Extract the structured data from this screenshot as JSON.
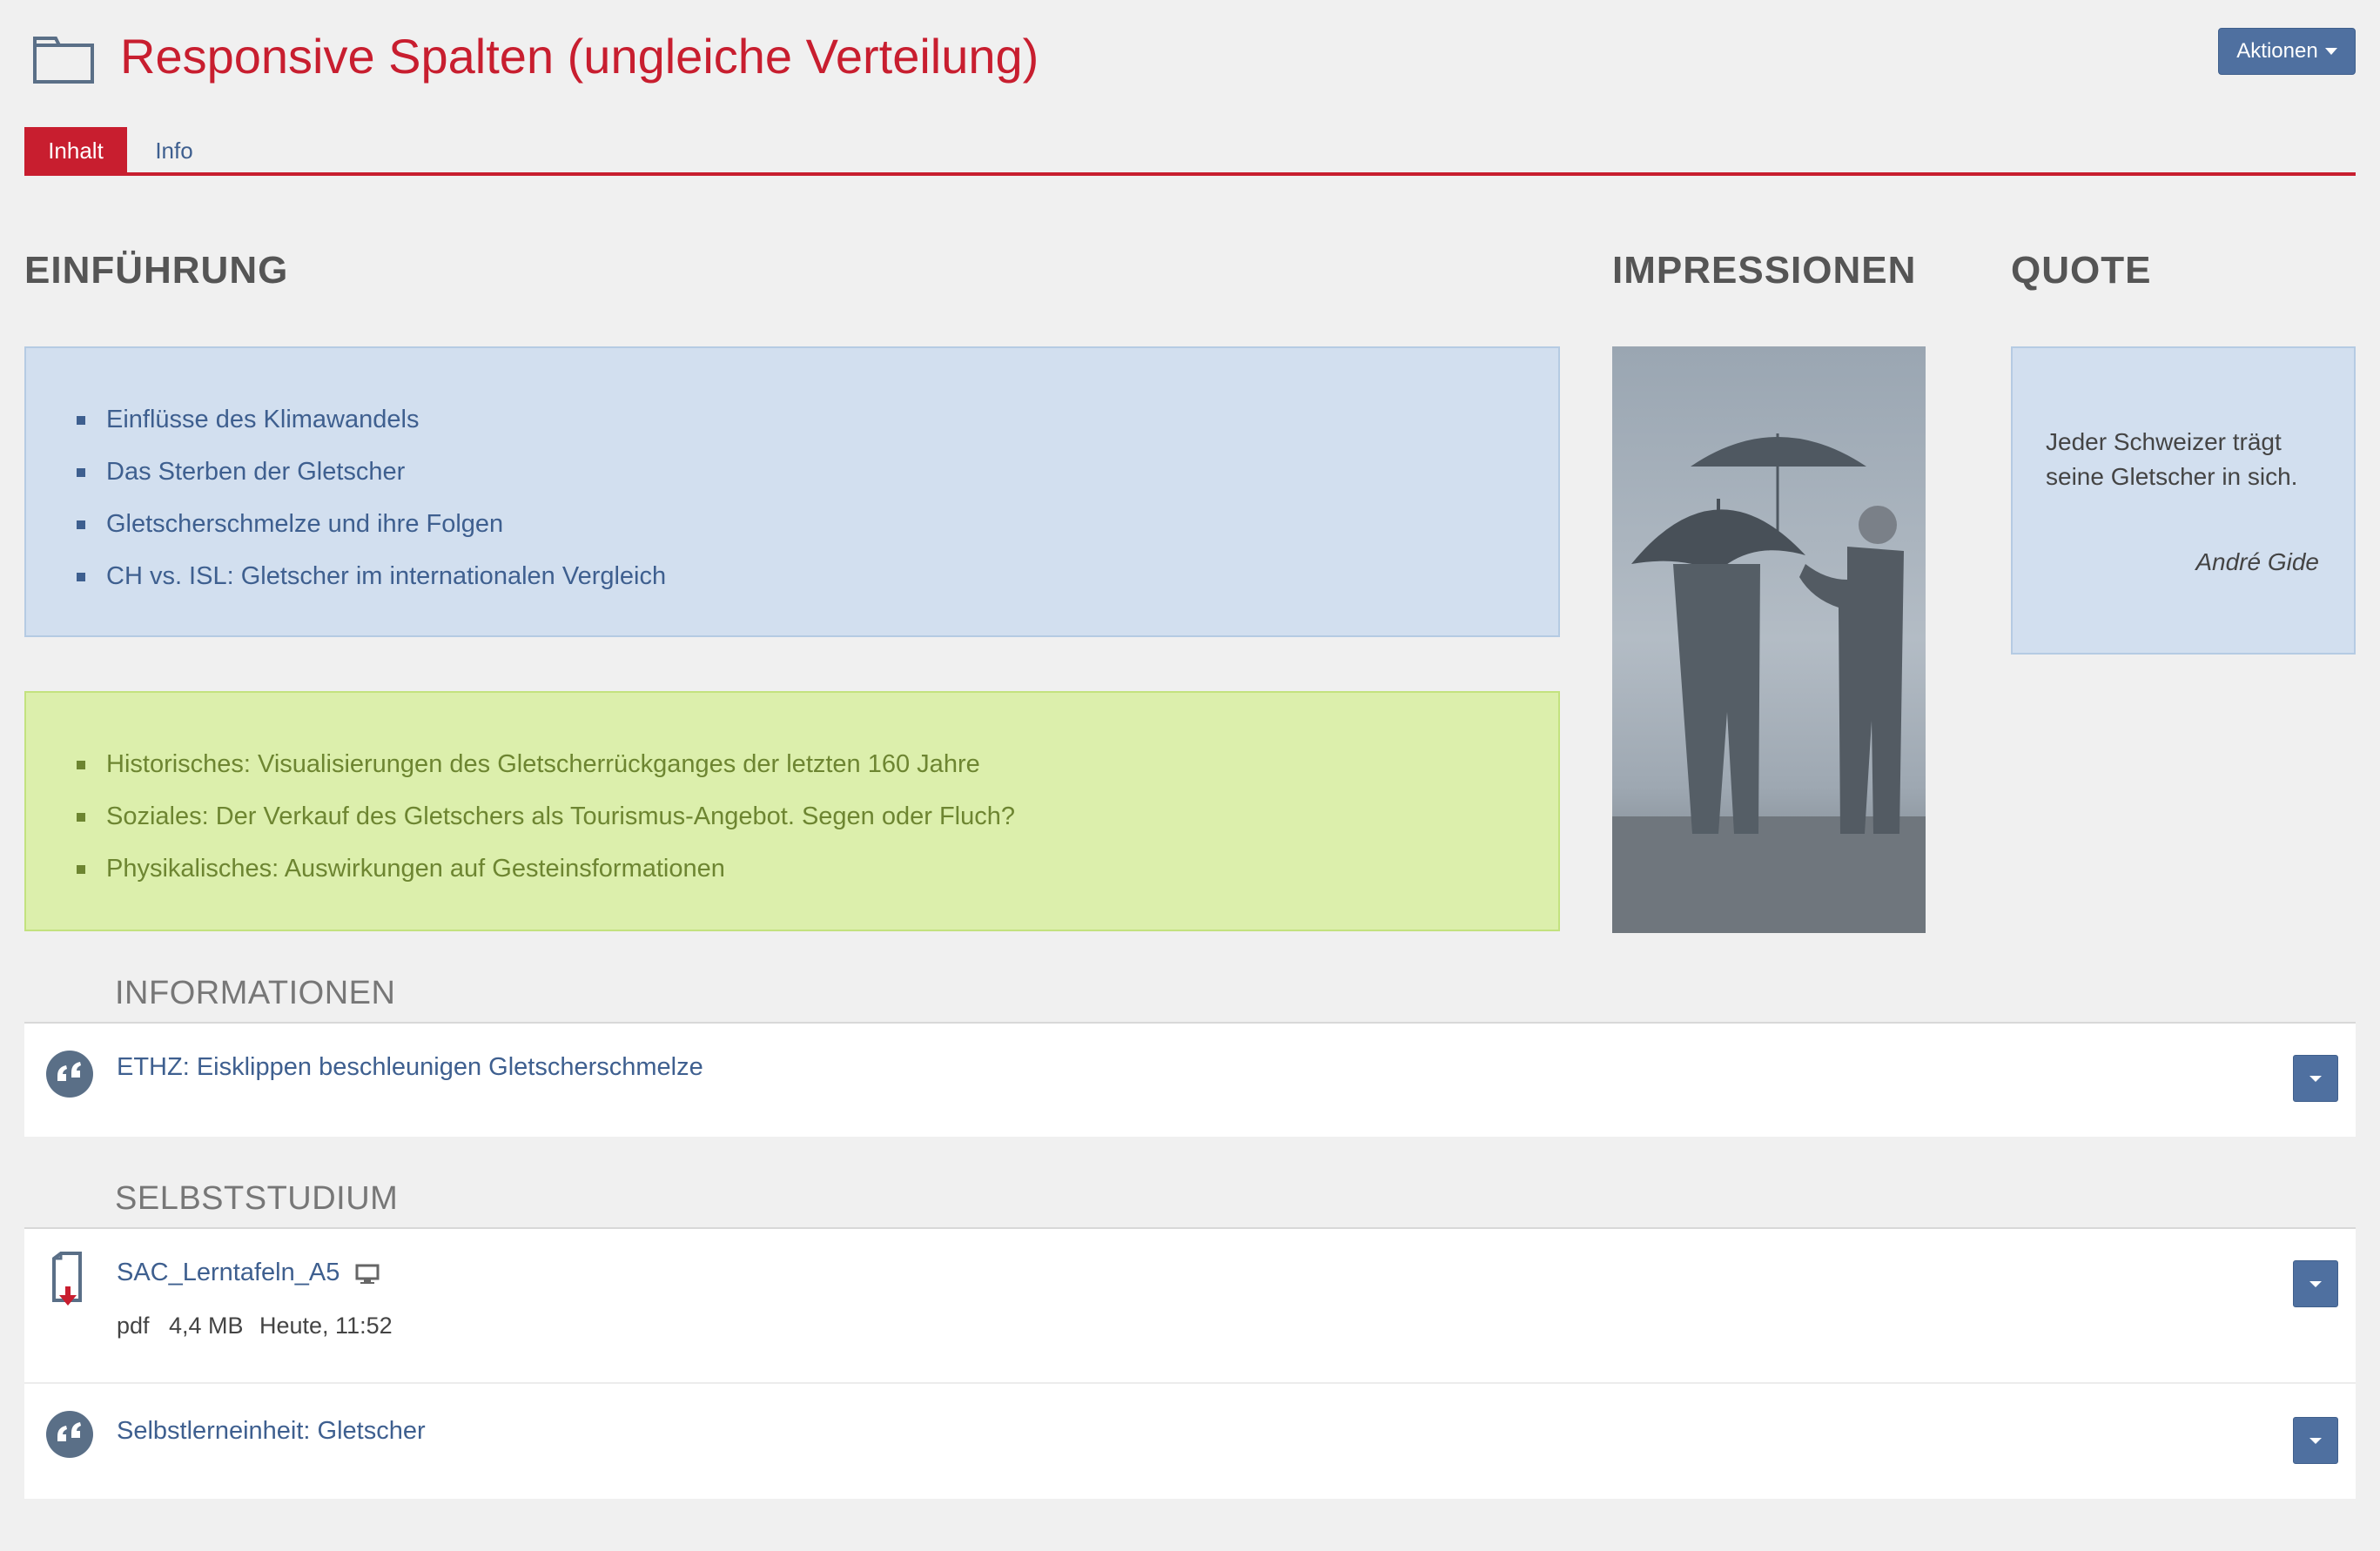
{
  "header": {
    "title": "Responsive Spalten (ungleiche Verteilung)",
    "actions_label": "Aktionen"
  },
  "tabs": [
    {
      "label": "Inhalt",
      "active": true
    },
    {
      "label": "Info",
      "active": false
    }
  ],
  "columns": {
    "einfuehrung": {
      "heading": "EINFÜHRUNG",
      "blue_items": [
        "Einflüsse des Klimawandels",
        "Das Sterben der Gletscher",
        "Gletscherschmelze und ihre Folgen",
        "CH vs. ISL: Gletscher im internationalen Vergleich"
      ],
      "green_items": [
        "Historisches: Visualisierungen des Gletscherrückganges der letzten 160 Jahre",
        "Soziales: Der Verkauf des Gletschers als Tourismus-Angebot. Segen oder Fluch?",
        "Physikalisches: Auswirkungen auf Gesteinsformationen"
      ]
    },
    "impressionen": {
      "heading": "IMPRESSIONEN"
    },
    "quote": {
      "heading": "QUOTE",
      "text": "Jeder Schweizer trägt seine Gletscher in sich.",
      "author": "André Gide"
    }
  },
  "sections": {
    "informationen": {
      "title": "INFORMATIONEN",
      "items": [
        {
          "label": "ETHZ: Eisklippen beschleunigen Gletscherschmelze",
          "icon": "quote-bubble-icon"
        }
      ]
    },
    "selbststudium": {
      "title": "SELBSTSTUDIUM",
      "items": [
        {
          "label": "SAC_Lerntafeln_A5",
          "icon": "file-download-icon",
          "type": "pdf",
          "size": "4,4 MB",
          "date": "Heute, 11:52"
        },
        {
          "label": "Selbstlerneinheit: Gletscher",
          "icon": "quote-bubble-icon"
        }
      ]
    }
  },
  "colors": {
    "brand_red": "#c81e2f",
    "link_blue": "#3e5f8f",
    "button_blue": "#4f70a0",
    "blue_box": "#d2dfef",
    "green_box": "#dcefac",
    "green_text": "#6d8531"
  }
}
